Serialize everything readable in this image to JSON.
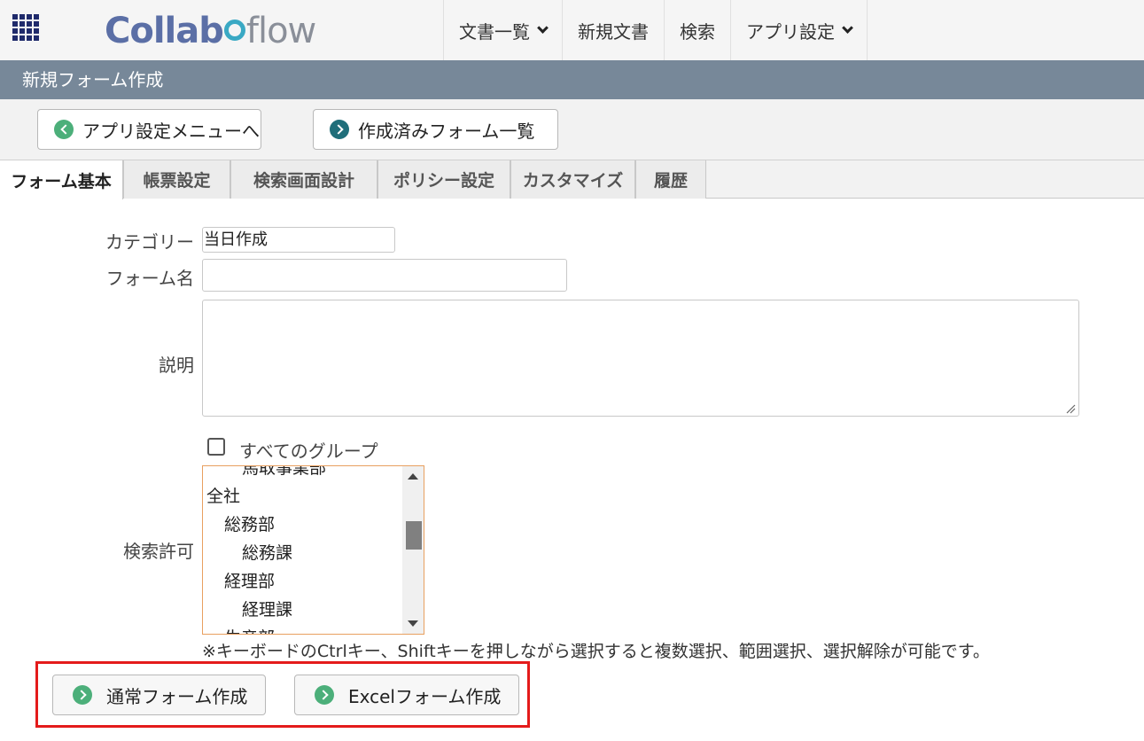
{
  "header": {
    "logo_text_1": "Collab",
    "logo_text_2": "flow",
    "nav": [
      {
        "label": "文書一覧",
        "has_dropdown": true
      },
      {
        "label": "新規文書",
        "has_dropdown": false
      },
      {
        "label": "検索",
        "has_dropdown": false
      },
      {
        "label": "アプリ設定",
        "has_dropdown": true
      }
    ]
  },
  "page_title": "新規フォーム作成",
  "toolbar": {
    "back_button": "アプリ設定メニューへ",
    "forms_button": "作成済みフォーム一覧"
  },
  "tabs": [
    {
      "label": "フォーム基本",
      "active": true
    },
    {
      "label": "帳票設定",
      "active": false
    },
    {
      "label": "検索画面設計",
      "active": false
    },
    {
      "label": "ポリシー設定",
      "active": false
    },
    {
      "label": "カスタマイズ",
      "active": false
    },
    {
      "label": "履歴",
      "active": false
    }
  ],
  "form": {
    "category_label": "カテゴリー",
    "category_value": "当日作成",
    "formname_label": "フォーム名",
    "formname_value": "",
    "description_label": "説明",
    "description_value": "",
    "search_permission_label": "検索許可",
    "all_groups_label": "すべてのグループ",
    "all_groups_checked": false,
    "groups": [
      {
        "label": "馬取事業部",
        "indent": 1
      },
      {
        "label": "全社",
        "indent": 0
      },
      {
        "label": "総務部",
        "indent": 1
      },
      {
        "label": "総務課",
        "indent": 2
      },
      {
        "label": "経理部",
        "indent": 1
      },
      {
        "label": "経理課",
        "indent": 2
      },
      {
        "label": "生産部",
        "indent": 1
      }
    ],
    "note": "※キーボードのCtrlキー、Shiftキーを押しながら選択すると複数選択、範囲選択、選択解除が可能です。"
  },
  "actions": {
    "normal_form": "通常フォーム作成",
    "excel_form": "Excelフォーム作成"
  },
  "colors": {
    "title_bar": "#778899",
    "highlight": "#e41b1b",
    "icon_green": "#4caf7a",
    "icon_teal": "#1f6e7a",
    "listbox_border": "#e8a060"
  }
}
